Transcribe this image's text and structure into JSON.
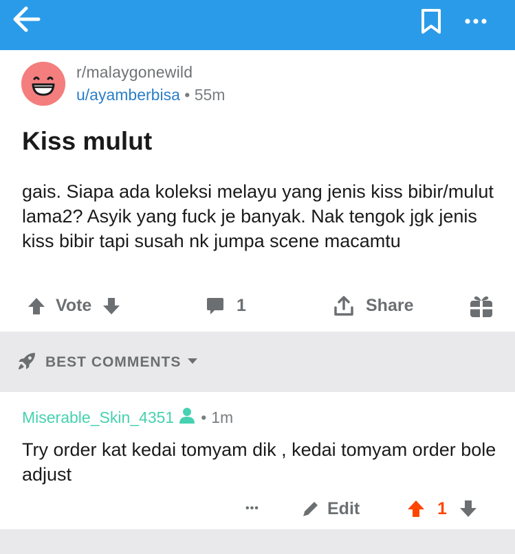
{
  "topbar": {
    "back_icon": "arrow-left-icon",
    "bookmark_icon": "bookmark-icon",
    "more_icon": "more-horizontal-icon",
    "color": "#2a9be8"
  },
  "post": {
    "subreddit": "r/malaygonewild",
    "author": "u/ayamberbisa",
    "separator": "•",
    "time": "55m",
    "title": "Kiss mulut",
    "body": "gais. Siapa ada koleksi melayu yang jenis kiss bibir/mulut lama2? Asyik yang fuck je banyak. Nak tengok jgk jenis kiss bibir tapi susah nk jumpa scene macamtu",
    "vote_label": "Vote",
    "comment_count": "1",
    "share_label": "Share",
    "avatar_color": "#f47e7e"
  },
  "comments_section": {
    "sort_label": "BEST COMMENTS",
    "comments": [
      {
        "author": "Miserable_Skin_4351",
        "separator": "•",
        "time": "1m",
        "body": "Try order kat kedai tomyam dik , kedai tomyam order bole adjust",
        "more_label": "•••",
        "edit_label": "Edit",
        "score": "1",
        "author_color": "#46d1b0",
        "upvote_color": "#ff4500"
      }
    ]
  }
}
